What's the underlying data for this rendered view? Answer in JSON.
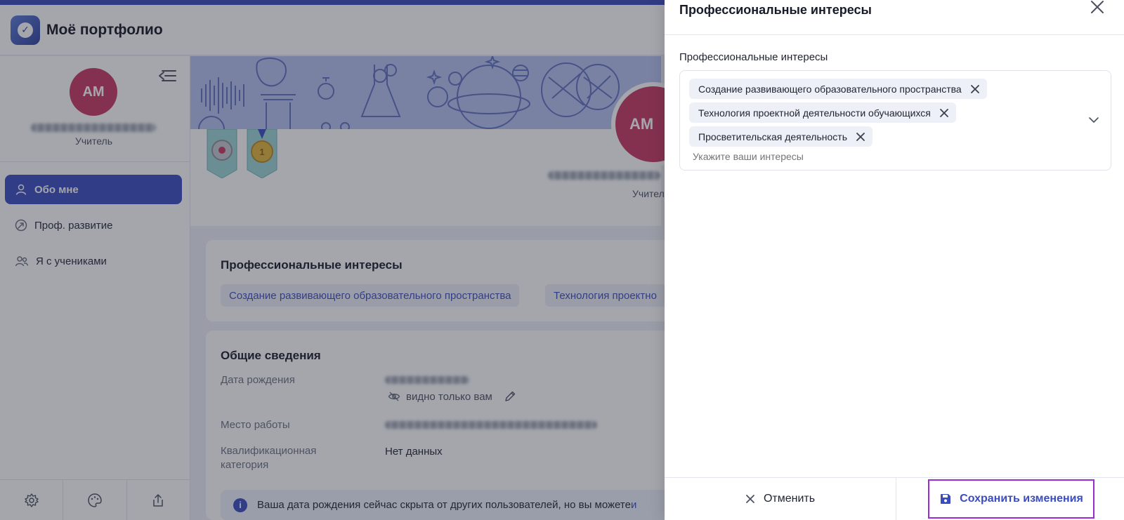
{
  "app": {
    "title": "Моё портфолио"
  },
  "sidebar": {
    "avatar_initials": "АМ",
    "role": "Учитель",
    "nav": [
      {
        "label": "Обо мне",
        "icon": "user-icon",
        "active": true
      },
      {
        "label": "Проф. развитие",
        "icon": "growth-icon",
        "active": false
      },
      {
        "label": "Я с учениками",
        "icon": "users-icon",
        "active": false
      }
    ],
    "bottom_icons": [
      "settings-icon",
      "palette-icon",
      "share-icon"
    ]
  },
  "profile": {
    "avatar_initials": "АМ",
    "role_partial": "Учител"
  },
  "interests_card": {
    "title": "Профессиональные интересы",
    "chips": [
      "Создание развивающего образовательного пространства",
      "Технология проектно"
    ]
  },
  "general_card": {
    "title": "Общие сведения",
    "birth_label": "Дата рождения",
    "visibility_text": "видно только вам",
    "work_label": "Место работы",
    "category_label_line1": "Квалификационная",
    "category_label_line2": "категория",
    "category_value": "Нет данных",
    "info_text": "Ваша дата рождения сейчас скрыта от других пользователей, но вы можете ",
    "info_link": "и"
  },
  "drawer": {
    "title": "Профессиональные интересы",
    "field_label": "Профессиональные интересы",
    "tags": [
      "Создание развивающего образовательного пространства",
      "Технология проектной деятельности обучающихся",
      "Просветительская деятельность"
    ],
    "placeholder": "Укажите ваши интересы",
    "cancel_label": "Отменить",
    "save_label": "Сохранить изменения"
  },
  "colors": {
    "accent": "#3a4cc0",
    "avatar": "#c9365f",
    "save_outline": "#9a2bd6"
  }
}
